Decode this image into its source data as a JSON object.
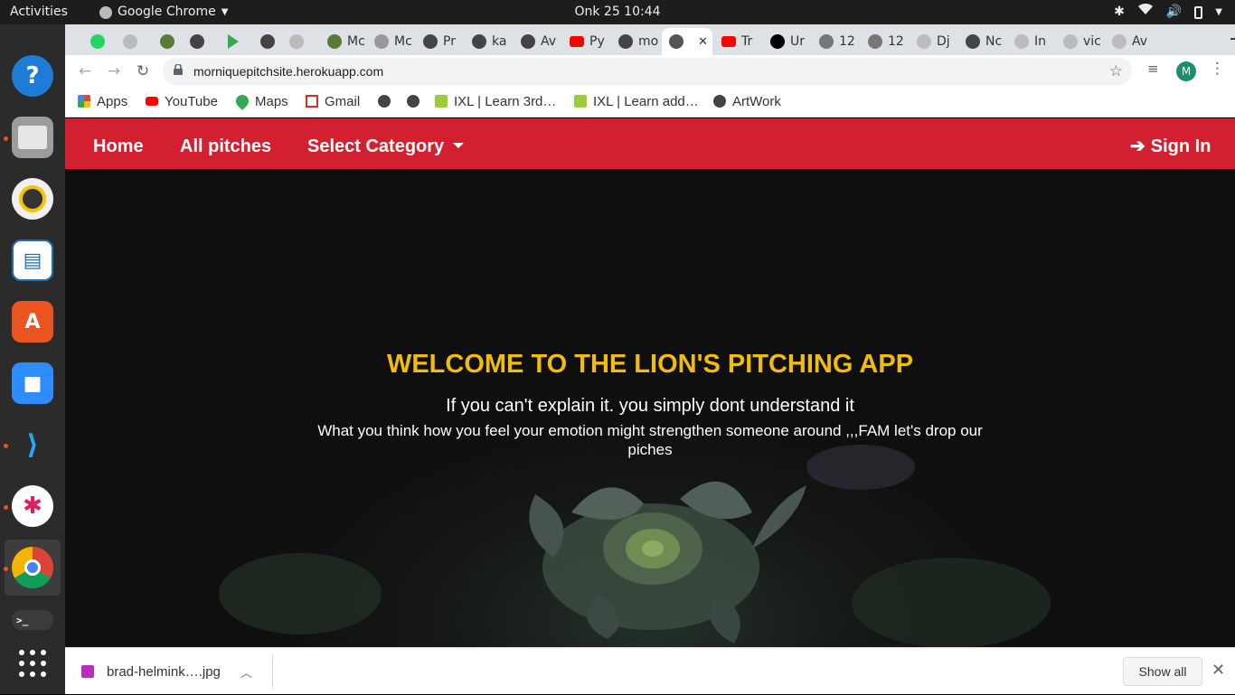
{
  "topbar": {
    "activities": "Activities",
    "app_menu": "Google Chrome",
    "clock": "Onk 25  10:44"
  },
  "tabs": [
    {
      "label": "",
      "icon": "whatsapp-icon",
      "color": "#25d366"
    },
    {
      "label": "",
      "icon": "globe-icon",
      "color": "#bbbbbb"
    },
    {
      "label": "",
      "icon": "palm-icon",
      "color": "#5a7a3a"
    },
    {
      "label": "",
      "icon": "github-icon",
      "color": "#444444"
    },
    {
      "label": "",
      "icon": "play-icon",
      "color": "#34a853"
    },
    {
      "label": "",
      "icon": "github-icon",
      "color": "#444444"
    },
    {
      "label": "",
      "icon": "globe-icon",
      "color": "#bbbbbb"
    },
    {
      "label": "Mc",
      "icon": "palm-icon",
      "color": "#5a7a3a"
    },
    {
      "label": "Mc",
      "icon": "globe-icon",
      "color": "#999999"
    },
    {
      "label": "Pr",
      "icon": "github-icon",
      "color": "#444444"
    },
    {
      "label": "ka",
      "icon": "github-icon",
      "color": "#444444"
    },
    {
      "label": "Av",
      "icon": "github-icon",
      "color": "#444444"
    },
    {
      "label": "Py",
      "icon": "youtube-icon",
      "color": "#ff0000"
    },
    {
      "label": "mo",
      "icon": "github-icon",
      "color": "#444444"
    },
    {
      "label": "",
      "icon": "globe-icon",
      "color": "#555555",
      "active": true
    },
    {
      "label": "Tr",
      "icon": "youtube-icon",
      "color": "#ff0000"
    },
    {
      "label": "Ur",
      "icon": "unsplash-icon",
      "color": "#000000"
    },
    {
      "label": "12",
      "icon": "globe-icon",
      "color": "#777777"
    },
    {
      "label": "12",
      "icon": "globe-icon",
      "color": "#777777"
    },
    {
      "label": "Dj",
      "icon": "globe-icon",
      "color": "#bbbbbb"
    },
    {
      "label": "Nc",
      "icon": "github-icon",
      "color": "#444444"
    },
    {
      "label": "In",
      "icon": "globe-icon",
      "color": "#bbbbbb"
    },
    {
      "label": "vic",
      "icon": "globe-icon",
      "color": "#bbbbbb"
    },
    {
      "label": "Av",
      "icon": "globe-icon",
      "color": "#bbbbbb"
    }
  ],
  "toolbar": {
    "url": "morniquepitchsite.herokuapp.com",
    "profile_initial": "M"
  },
  "bookmarks": [
    {
      "label": "Apps",
      "icon": "apps-grid-icon"
    },
    {
      "label": "YouTube",
      "icon": "youtube-icon"
    },
    {
      "label": "Maps",
      "icon": "maps-pin-icon"
    },
    {
      "label": "Gmail",
      "icon": "gmail-icon"
    },
    {
      "label": "",
      "icon": "globe-icon"
    },
    {
      "label": "",
      "icon": "globe-icon"
    },
    {
      "label": "IXL | Learn 3rd…",
      "icon": "ixl-icon"
    },
    {
      "label": "IXL | Learn add…",
      "icon": "ixl-icon"
    },
    {
      "label": "ArtWork",
      "icon": "globe-icon"
    }
  ],
  "site": {
    "nav": {
      "home": "Home",
      "all_pitches": "All pitches",
      "select_category": "Select Category",
      "sign_in": "Sign In"
    },
    "hero": {
      "title": "WELCOME TO THE LION'S PITCHING APP",
      "quote": "If you can't explain it. you simply dont understand it",
      "subtitle": "What you think how you feel your emotion might strengthen someone around ,,,FAM let's drop our piches"
    },
    "colors": {
      "nav_bg": "#d32030",
      "title": "#f2bc0c"
    }
  },
  "downloads": {
    "filename": "brad-helmink….jpg",
    "show_all": "Show all"
  }
}
